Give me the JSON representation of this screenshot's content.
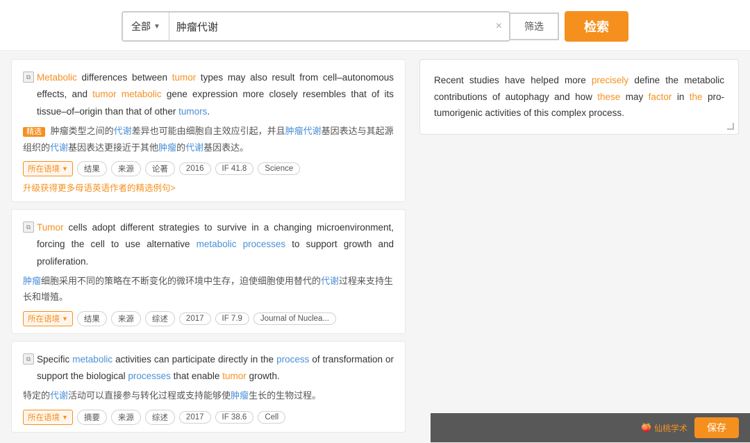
{
  "search": {
    "category_label": "全部",
    "query": "肿瘤代谢",
    "clear_label": "×",
    "filter_label": "筛选",
    "search_label": "检索"
  },
  "context": {
    "text": "Recent studies have helped more precisely define the metabolic contributions of autophagy and how these may factor in the pro-tumorigenic activities of this complex process."
  },
  "results": [
    {
      "id": 1,
      "english": "Metabolic differences between tumor types may also result from cell–autonomous effects, and tumor metabolic gene expression more closely resembles that of its tissue–of–origin than that of other tumors.",
      "chinese": "精选 肿瘤类型之间的代谢差异也可能由细胞自主效应引起，并且肿瘤代谢基因表达与其起源组织的代谢基因表达更接近于其他肿瘤的代谢基因表达。",
      "upgrade_text": "升级获得更多母语英语作者的精选例句>",
      "tags": [
        "所在语境",
        "结果",
        "来源",
        "论著",
        "2016",
        "IF 41.8",
        "Science"
      ]
    },
    {
      "id": 2,
      "english": "Tumor cells adopt different strategies to survive in a changing microenvironment, forcing the cell to use alternative metabolic processes to support growth and proliferation.",
      "chinese": "肿瘤细胞采用不同的策略在不断变化的微环境中生存，迫使细胞使用替代的代谢过程来支持生长和增殖。",
      "tags": [
        "所在语境",
        "结果",
        "来源",
        "综述",
        "2017",
        "IF 7.9",
        "Journal of Nuclea..."
      ]
    },
    {
      "id": 3,
      "english": "Specific metabolic activities can participate directly in the process of transformation or support the biological processes that enable tumor growth.",
      "chinese": "特定的代谢活动可以直接参与转化过程或支持能够使肿瘤生长的生物过程。",
      "tags": [
        "所在语境",
        "摘要",
        "来源",
        "综述",
        "2017",
        "IF 38.6",
        "Cell"
      ]
    }
  ],
  "brand": {
    "icon": "🍑",
    "name": "仙桃学术",
    "save_label": "保存"
  }
}
